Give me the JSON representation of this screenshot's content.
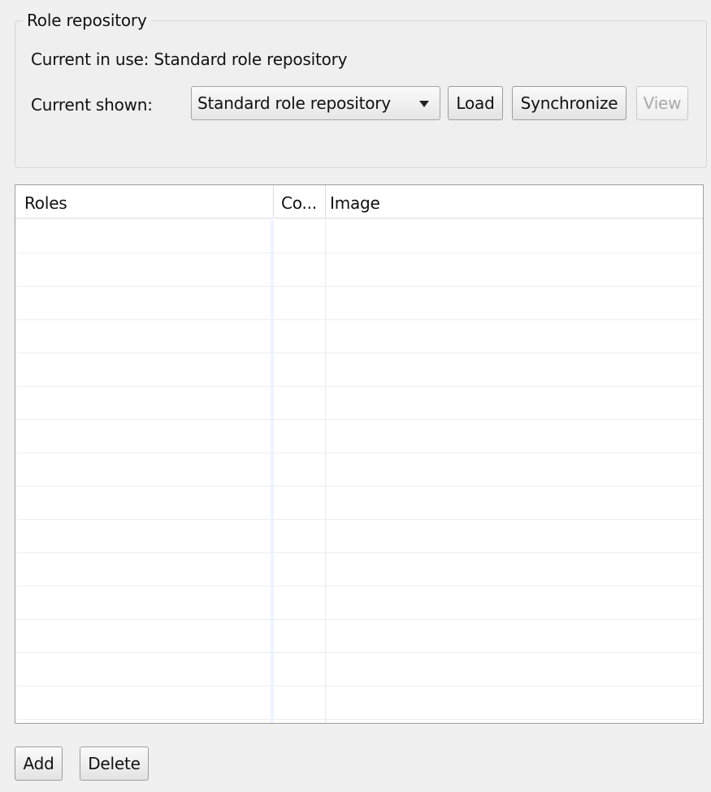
{
  "repository": {
    "group_title": "Role repository",
    "current_in_use": "Current in use: Standard role repository",
    "current_shown_label": "Current shown:",
    "current_shown_value": "Standard role repository",
    "buttons": {
      "load": "Load",
      "synchronize": "Synchronize",
      "view": "View"
    }
  },
  "table": {
    "headers": [
      "Roles",
      "Co...",
      "Image"
    ]
  },
  "footer_buttons": {
    "add": "Add",
    "delete": "Delete"
  }
}
